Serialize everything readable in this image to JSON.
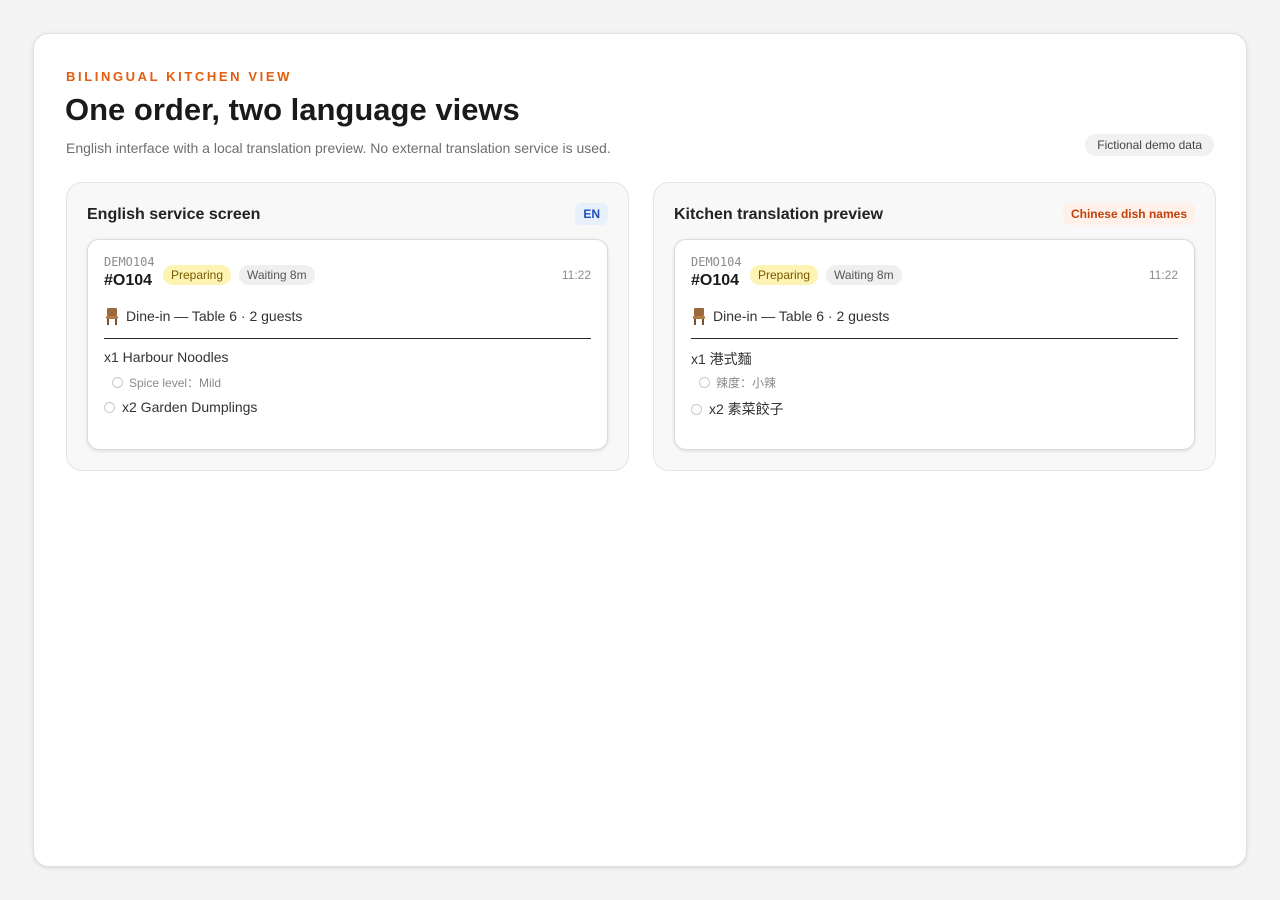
{
  "header": {
    "eyebrow": "BILINGUAL KITCHEN VIEW",
    "title": "One order, two language views",
    "subtitle": "English interface with a local translation preview. No external translation service is used.",
    "badge": "Fictional demo data"
  },
  "panels": [
    {
      "title": "English service screen",
      "badge": "EN",
      "order": {
        "code": "DEMO104",
        "number": "#O104",
        "status": "Preparing",
        "waiting": "Waiting 8m",
        "time": "11:22",
        "service": "Dine-in — Table 6 · 2 guests",
        "items": [
          {
            "label": "x1 Harbour Noodles",
            "modifier": "Spice level：Mild"
          },
          {
            "label": "x2 Garden Dumplings"
          }
        ]
      }
    },
    {
      "title": "Kitchen translation preview",
      "badge": "Chinese dish names",
      "order": {
        "code": "DEMO104",
        "number": "#O104",
        "status": "Preparing",
        "waiting": "Waiting 8m",
        "time": "11:22",
        "service": "Dine-in — Table 6 · 2 guests",
        "items": [
          {
            "label": "x1 港式麵",
            "modifier": "辣度：小辣"
          },
          {
            "label": "x2 素菜餃子"
          }
        ]
      }
    }
  ],
  "icons": {
    "service": "chair-icon",
    "item_check": "circle-icon"
  },
  "colors": {
    "accent": "#e35d0c",
    "status_bg": "#fdf3b3",
    "en_badge": "#1d4fb8",
    "zh_badge": "#c2410c"
  }
}
